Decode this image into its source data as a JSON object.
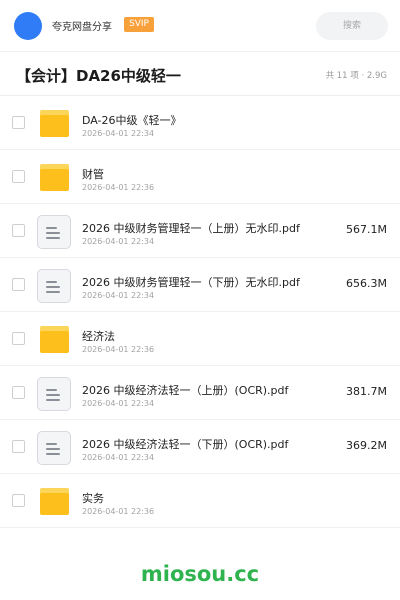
{
  "header": {
    "app_name": "夸克网盘分享",
    "badge": "SVIP",
    "search_label": "搜索"
  },
  "share": {
    "title": "【会计】DA26中级轻一",
    "meta": "共 11 项 · 2.9G"
  },
  "files": [
    {
      "name": "DA-26中级《轻一》",
      "date": "2026-04-01 22:34",
      "size": "",
      "type": "folder"
    },
    {
      "name": "财管",
      "date": "2026-04-01 22:36",
      "size": "",
      "type": "folder"
    },
    {
      "name": "2026 中级财务管理轻一（上册）无水印.pdf",
      "date": "2026-04-01 22:34",
      "size": "567.1M",
      "type": "pdf"
    },
    {
      "name": "2026 中级财务管理轻一（下册）无水印.pdf",
      "date": "2026-04-01 22:34",
      "size": "656.3M",
      "type": "pdf"
    },
    {
      "name": "经济法",
      "date": "2026-04-01 22:36",
      "size": "",
      "type": "folder"
    },
    {
      "name": "2026 中级经济法轻一（上册）(OCR).pdf",
      "date": "2026-04-01 22:34",
      "size": "381.7M",
      "type": "pdf"
    },
    {
      "name": "2026 中级经济法轻一（下册）(OCR).pdf",
      "date": "2026-04-01 22:34",
      "size": "369.2M",
      "type": "pdf"
    },
    {
      "name": "实务",
      "date": "2026-04-01 22:36",
      "size": "",
      "type": "folder"
    }
  ],
  "watermark": "miosou.cc",
  "colors": {
    "accent_blue": "#2f7cf6",
    "svip_orange": "#f8a03a",
    "folder_yellow": "#fdbf1c",
    "watermark_green": "#2fb34e"
  },
  "icons": {
    "folder": "folder-icon",
    "pdf": "document-icon"
  }
}
